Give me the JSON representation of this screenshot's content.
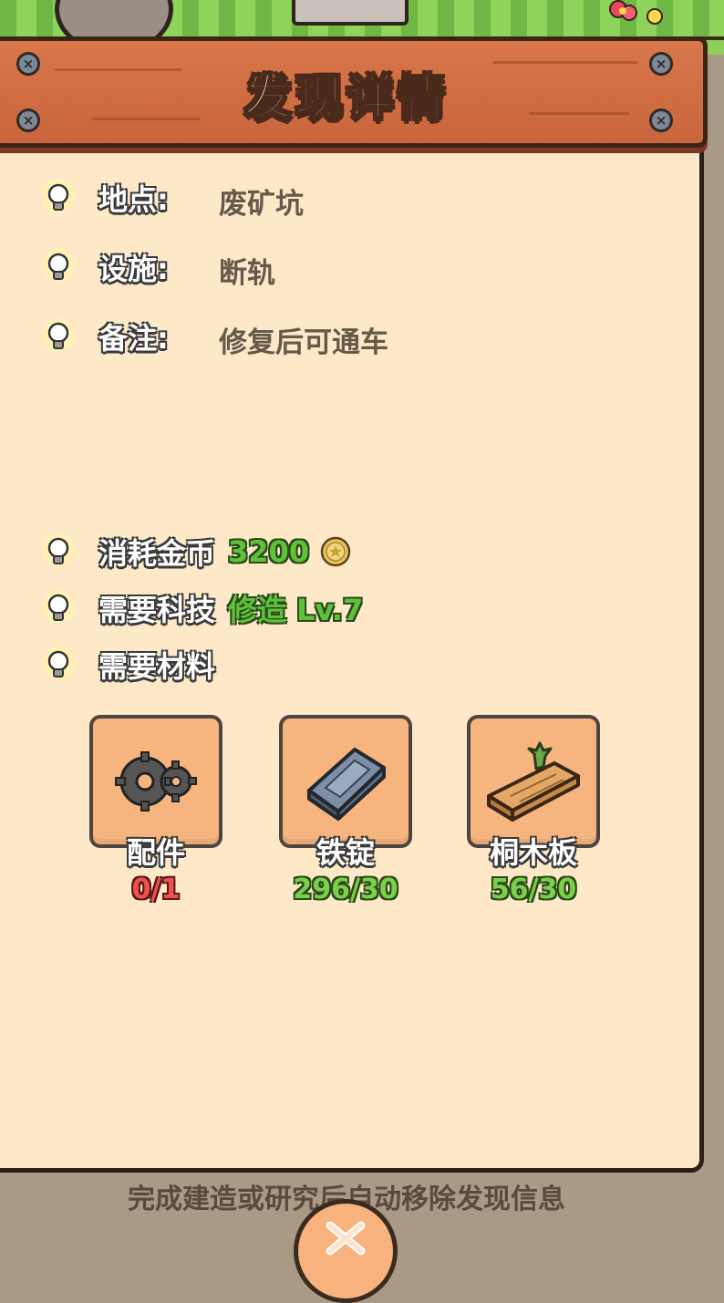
{
  "dialog": {
    "title": "发现详情",
    "location_label": "地点:",
    "location_value": "废矿坑",
    "facility_label": "设施:",
    "facility_value": "断轨",
    "note_label": "备注:",
    "note_value": "修复后可通车",
    "cost_label": "消耗金币",
    "cost_value": "3200",
    "tech_label": "需要科技",
    "tech_value": "修造 Lv.7",
    "materials_label": "需要材料",
    "materials": [
      {
        "name": "配件",
        "count": "0/1",
        "icon": "gears-icon",
        "status": "insufficient"
      },
      {
        "name": "铁锭",
        "count": "296/30",
        "icon": "iron-ingot-icon",
        "status": "sufficient"
      },
      {
        "name": "桐木板",
        "count": "56/30",
        "icon": "wood-plank-icon",
        "status": "sufficient"
      }
    ],
    "footer_note": "完成建造或研究后自动移除发现信息"
  },
  "colors": {
    "panel_bg": "#fde9c8",
    "banner": "#d9774b",
    "green_value": "#5fc23a",
    "red_value": "#f05050",
    "material_tile": "#f6b47f"
  }
}
